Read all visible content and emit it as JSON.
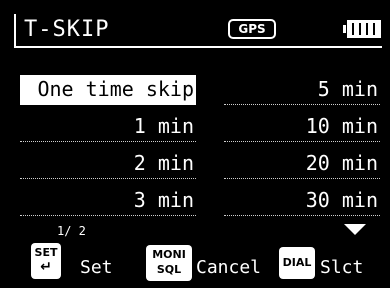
{
  "header": {
    "title": "T-SKIP",
    "gps_label": "GPS",
    "battery_icon": "battery-full-icon"
  },
  "menu": {
    "left": [
      "One time skip",
      "1 min",
      "2 min",
      "3 min"
    ],
    "right": [
      "5 min",
      "10 min",
      "20 min",
      "30 min"
    ],
    "selected": "One time skip"
  },
  "pagination": {
    "text": "1/ 2"
  },
  "softkeys": {
    "set": {
      "key_line1": "SET",
      "key_line2": "↵",
      "label": "Set"
    },
    "moni": {
      "key_line1": "MONI",
      "key_line2": "SQL",
      "label": "Cancel"
    },
    "dial": {
      "key_label": "DIAL",
      "label": "Slct"
    }
  },
  "colors": {
    "background": "#000000",
    "foreground": "#ffffff"
  }
}
